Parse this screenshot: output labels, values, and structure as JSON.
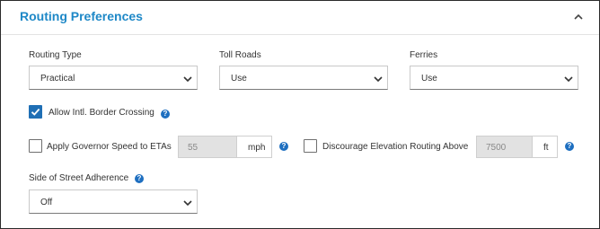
{
  "panel": {
    "title": "Routing Preferences",
    "collapse_icon": "chevron-up-icon"
  },
  "routing_type": {
    "label": "Routing Type",
    "value": "Practical"
  },
  "toll_roads": {
    "label": "Toll Roads",
    "value": "Use"
  },
  "ferries": {
    "label": "Ferries",
    "value": "Use"
  },
  "border_crossing": {
    "label": "Allow Intl. Border Crossing",
    "checked": true
  },
  "governor_speed": {
    "label": "Apply Governor Speed to ETAs",
    "checked": false,
    "value": "55",
    "unit": "mph"
  },
  "elevation": {
    "label": "Discourage Elevation Routing Above",
    "checked": false,
    "value": "7500",
    "unit": "ft"
  },
  "side_of_street": {
    "label": "Side of Street Adherence",
    "value": "Off"
  },
  "help_glyph": "?",
  "colors": {
    "accent": "#1e88c7",
    "checkbox_checked": "#1f6fb5",
    "help_icon": "#1e6fc0"
  }
}
